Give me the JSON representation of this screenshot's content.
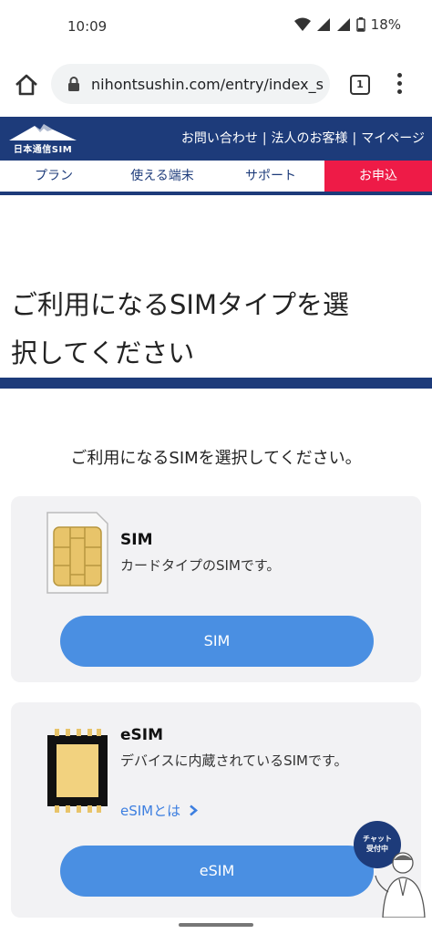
{
  "status_bar": {
    "time": "10:09",
    "battery": "18%"
  },
  "browser": {
    "url": "nihontsushin.com/entry/index_s",
    "tab_count": "1"
  },
  "site_header": {
    "logo_text": "日本通信SIM",
    "links": [
      "お問い合わせ",
      "法人のお客様",
      "マイページ"
    ],
    "separator": "|"
  },
  "nav": {
    "items": [
      "プラン",
      "使える端末",
      "サポート",
      "お申込"
    ]
  },
  "page": {
    "title_line1": "ご利用になるSIMタイプを選",
    "title_line2": "択してください",
    "instruction": "ご利用になるSIMを選択してください。"
  },
  "sim_card": {
    "name": "SIM",
    "description": "カードタイプのSIMです。",
    "button_label": "SIM"
  },
  "esim_card": {
    "name": "eSIM",
    "description": "デバイスに内蔵されているSIMです。",
    "link_label": "eSIMとは",
    "button_label": "eSIM"
  },
  "chat": {
    "line1": "チャット",
    "line2": "受付中"
  },
  "colors": {
    "brand_navy": "#1d3b7a",
    "apply_red": "#ee1b47",
    "button_blue": "#4a8fe2",
    "link_blue": "#3d7fe0"
  }
}
